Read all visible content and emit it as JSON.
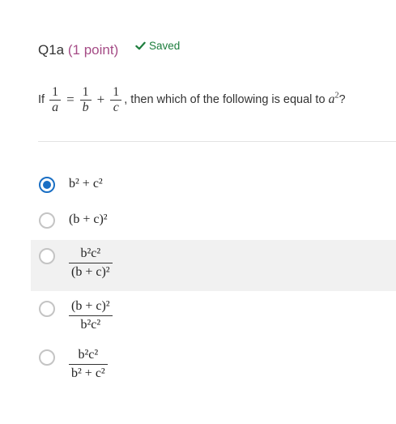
{
  "question": {
    "number": "Q1a",
    "points": "(1 point)",
    "saved_label": "Saved",
    "stem_prefix": "If",
    "stem_suffix": ", then which of the following is equal to",
    "stem_end": "?",
    "frac_one": "1",
    "var_a": "a",
    "var_b": "b",
    "var_c": "c",
    "target": "a",
    "target_exp": "2"
  },
  "options": [
    {
      "text": "b² + c²",
      "selected": true
    },
    {
      "text": "(b + c)²",
      "selected": false
    },
    {
      "numerator": "b²c²",
      "denominator": "(b + c)²",
      "selected": false
    },
    {
      "numerator": "(b + c)²",
      "denominator": "b²c²",
      "selected": false
    },
    {
      "numerator": "b²c²",
      "denominator": "b² + c²",
      "selected": false
    }
  ],
  "colors": {
    "accent": "#1a6fc4",
    "points": "#a54c86",
    "saved": "#1e7e3e",
    "highlight": "#f1f1f1"
  }
}
